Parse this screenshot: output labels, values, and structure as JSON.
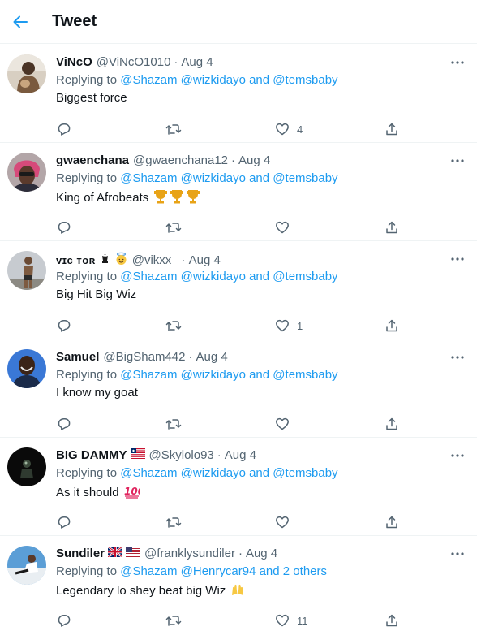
{
  "header": {
    "title": "Tweet"
  },
  "replying_prefix": "Replying to",
  "tweets": [
    {
      "name": "ViNcO",
      "handle": "@ViNcO1010",
      "date": "Aug 4",
      "mentions": [
        "@Shazam",
        "@wizkidayo"
      ],
      "and_text": "and",
      "last_mention": "@temsbaby",
      "text": "Biggest force",
      "likes": "4"
    },
    {
      "name": "gwaenchana",
      "handle": "@gwaenchana12",
      "date": "Aug 4",
      "mentions": [
        "@Shazam",
        "@wizkidayo"
      ],
      "and_text": "and",
      "last_mention": "@temsbaby",
      "text": "King of Afrobeats",
      "likes": ""
    },
    {
      "name": "ᴠɪᴄ ᴛᴏʀ",
      "handle": "@vikxx_",
      "date": "Aug 4",
      "mentions": [
        "@Shazam",
        "@wizkidayo"
      ],
      "and_text": "and",
      "last_mention": "@temsbaby",
      "text": "Big Hit Big Wiz",
      "likes": "1"
    },
    {
      "name": "Samuel",
      "handle": "@BigSham442",
      "date": "Aug 4",
      "mentions": [
        "@Shazam",
        "@wizkidayo"
      ],
      "and_text": "and",
      "last_mention": "@temsbaby",
      "text": "I know my goat",
      "likes": ""
    },
    {
      "name": "BIG DAMMY",
      "handle": "@Skylolo93",
      "date": "Aug 4",
      "mentions": [
        "@Shazam",
        "@wizkidayo"
      ],
      "and_text": "and",
      "last_mention": "@temsbaby",
      "text": "As it should",
      "likes": ""
    },
    {
      "name": "Sundiler",
      "handle": "@franklysundiler",
      "date": "Aug 4",
      "mentions": [
        "@Shazam",
        "@Henrycar94"
      ],
      "and_text": "and",
      "last_mention": "2 others",
      "text": "Legendary lo shey beat big Wiz",
      "likes": "11"
    }
  ],
  "colors": {
    "link": "#1d9bf0",
    "secondary": "#536471",
    "text": "#0f1419",
    "divider": "#eff3f4"
  },
  "icons": {
    "back": "arrow-left-icon",
    "more": "more-dots-icon",
    "reply": "reply-icon",
    "retweet": "retweet-icon",
    "like": "heart-icon",
    "share": "share-icon"
  }
}
